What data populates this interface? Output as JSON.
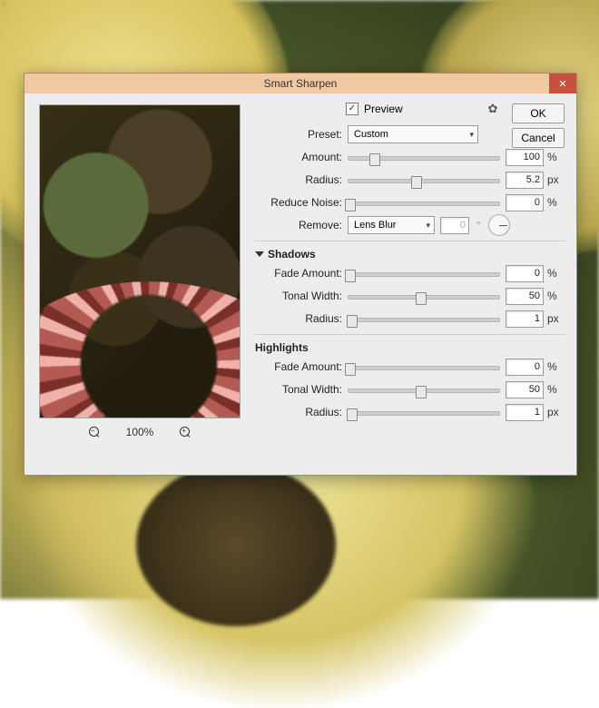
{
  "window": {
    "title": "Smart Sharpen",
    "close_icon": "✕"
  },
  "buttons": {
    "ok": "OK",
    "cancel": "Cancel"
  },
  "preview": {
    "checkbox_checked": "✓",
    "label": "Preview",
    "zoom_out_sign": "−",
    "zoom_pct": "100%",
    "zoom_in_sign": "+"
  },
  "gear": {
    "glyph": "✿"
  },
  "preset": {
    "label": "Preset:",
    "value": "Custom"
  },
  "main": {
    "amount": {
      "label": "Amount:",
      "value": "100",
      "unit": "%",
      "pos": 18
    },
    "radius": {
      "label": "Radius:",
      "value": "5.2",
      "unit": "px",
      "pos": 45
    },
    "reduce_noise": {
      "label": "Reduce Noise:",
      "value": "0",
      "unit": "%",
      "pos": 2
    }
  },
  "remove": {
    "label": "Remove:",
    "value": "Lens Blur",
    "angle_value": "0",
    "angle_unit": "°"
  },
  "shadows": {
    "heading": "Shadows",
    "fade_amount": {
      "label": "Fade Amount:",
      "value": "0",
      "unit": "%",
      "pos": 2
    },
    "tonal_width": {
      "label": "Tonal Width:",
      "value": "50",
      "unit": "%",
      "pos": 48
    },
    "radius": {
      "label": "Radius:",
      "value": "1",
      "unit": "px",
      "pos": 3
    }
  },
  "highlights": {
    "heading": "Highlights",
    "fade_amount": {
      "label": "Fade Amount:",
      "value": "0",
      "unit": "%",
      "pos": 2
    },
    "tonal_width": {
      "label": "Tonal Width:",
      "value": "50",
      "unit": "%",
      "pos": 48
    },
    "radius": {
      "label": "Radius:",
      "value": "1",
      "unit": "px",
      "pos": 3
    }
  }
}
